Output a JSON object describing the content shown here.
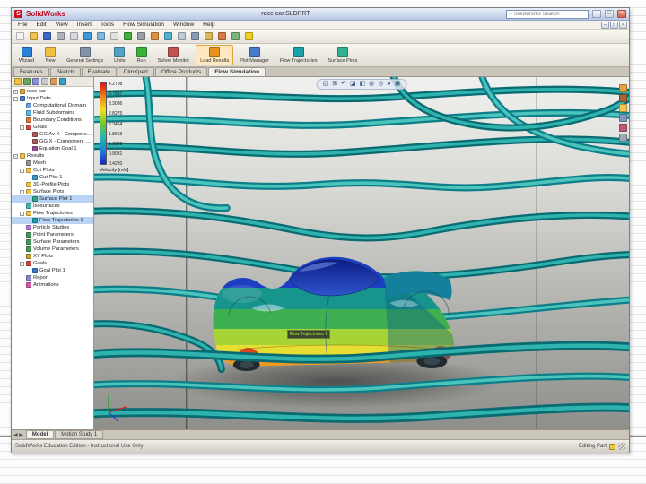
{
  "window": {
    "app_name": "SolidWorks",
    "logo_letter": "S",
    "document_title": "race car.SLDPRT",
    "search_placeholder": "SolidWorks Search",
    "window_buttons": {
      "minimize": "─",
      "maximize": "□",
      "close": "×"
    },
    "menus": [
      "File",
      "Edit",
      "View",
      "Insert",
      "Tools",
      "Flow Simulation",
      "Window",
      "Help"
    ],
    "std_toolbar": [
      {
        "name": "new-icon",
        "color": "#f4f4f4"
      },
      {
        "name": "open-icon",
        "color": "#f2c24a"
      },
      {
        "name": "save-icon",
        "color": "#3f69c8"
      },
      {
        "name": "print-icon",
        "color": "#aeb2ba"
      },
      {
        "name": "print-preview-icon",
        "color": "#d5dae2"
      },
      {
        "name": "undo-icon",
        "color": "#3c9ad8"
      },
      {
        "name": "redo-icon",
        "color": "#7db8e0"
      },
      {
        "name": "select-icon",
        "color": "#e2e2de"
      },
      {
        "name": "rebuild-icon",
        "color": "#3fae3f"
      },
      {
        "name": "options-icon",
        "color": "#98a0a8"
      },
      {
        "name": "edit-appearance-icon",
        "color": "#e09040"
      },
      {
        "name": "section-view-icon",
        "color": "#52b2d2"
      },
      {
        "name": "view-orientation-icon",
        "color": "#c2cad8"
      },
      {
        "name": "display-style-icon",
        "color": "#8a9ab8"
      },
      {
        "name": "hide-show-icon",
        "color": "#d8ba58"
      },
      {
        "name": "appearances-icon",
        "color": "#d87a42"
      },
      {
        "name": "scene-icon",
        "color": "#7ab878"
      },
      {
        "name": "help-icon",
        "color": "#f0d022"
      }
    ],
    "command_buttons": [
      {
        "name": "wizard-button",
        "label": "Wizard",
        "color": "#2a80d4"
      },
      {
        "name": "new-project-button",
        "label": "New",
        "color": "#f0c040"
      },
      {
        "name": "general-settings-button",
        "label": "General Settings",
        "color": "#8292a8"
      },
      {
        "name": "units-button",
        "label": "Units",
        "color": "#52a2c8"
      },
      {
        "name": "run-button",
        "label": "Run",
        "color": "#3ab23a"
      },
      {
        "name": "solver-monitor-button",
        "label": "Solver Monitor",
        "color": "#c25252"
      },
      {
        "name": "load-results-button",
        "label": "Load Results",
        "color": "#e89222",
        "active": true
      },
      {
        "name": "plot-manager-button",
        "label": "Plot Manager",
        "color": "#4a7ac8"
      },
      {
        "name": "flow-trajectories-button",
        "label": "Flow Trajectories",
        "color": "#1aa2aa"
      },
      {
        "name": "surface-plots-button",
        "label": "Surface Plots",
        "color": "#32b092"
      }
    ],
    "tabs": [
      {
        "label": "Features"
      },
      {
        "label": "Sketch"
      },
      {
        "label": "Evaluate"
      },
      {
        "label": "DimXpert"
      },
      {
        "label": "Office Products"
      },
      {
        "label": "Flow Simulation",
        "active": true
      }
    ],
    "panel_tabs": [
      {
        "name": "featuremanager-tab-icon",
        "color": "#f0c040"
      },
      {
        "name": "propertymanager-tab-icon",
        "color": "#68a858"
      },
      {
        "name": "configurationmanager-tab-icon",
        "color": "#8890d8"
      },
      {
        "name": "dimxpertmanager-tab-icon",
        "color": "#c8c8c8"
      },
      {
        "name": "displaymanager-tab-icon",
        "color": "#d89858"
      },
      {
        "name": "flow-simulation-tab-icon",
        "color": "#38a0c8"
      }
    ],
    "tree": {
      "items": [
        {
          "depth": 0,
          "expand": "-",
          "label": "race car",
          "color": "#d8a838",
          "name": "tree-item-part"
        },
        {
          "depth": 0,
          "expand": "-",
          "label": "Input Data",
          "color": "#4a78c8",
          "name": "tree-item-input-data"
        },
        {
          "depth": 1,
          "expand": "",
          "label": "Computational Domain",
          "color": "#6f9fe0",
          "name": "tree-item-computational-domain"
        },
        {
          "depth": 1,
          "expand": "",
          "label": "Fluid Subdomains",
          "color": "#58b8e0",
          "name": "tree-item-fluid-subdomains"
        },
        {
          "depth": 1,
          "expand": "",
          "label": "Boundary Conditions",
          "color": "#e07838",
          "name": "tree-item-boundary-conditions"
        },
        {
          "depth": 1,
          "expand": "-",
          "label": "Goals",
          "color": "#d04848",
          "name": "tree-item-goals"
        },
        {
          "depth": 2,
          "expand": "",
          "label": "GG Av X - Component of...",
          "color": "#b05858",
          "name": "tree-item-goal-av-x"
        },
        {
          "depth": 2,
          "expand": "",
          "label": "GG X - Component of F...",
          "color": "#b05858",
          "name": "tree-item-goal-x"
        },
        {
          "depth": 2,
          "expand": "",
          "label": "Equation Goal 1",
          "color": "#a04898",
          "name": "tree-item-equation-goal-1"
        },
        {
          "depth": 0,
          "expand": "-",
          "label": "Results",
          "color": "#efc34a",
          "name": "tree-item-results"
        },
        {
          "depth": 1,
          "expand": "",
          "label": "Mesh",
          "color": "#909090",
          "name": "tree-item-mesh"
        },
        {
          "depth": 1,
          "expand": "-",
          "label": "Cut Plots",
          "color": "#efc34a",
          "name": "tree-item-cut-plots"
        },
        {
          "depth": 2,
          "expand": "",
          "label": "Cut Plot 1",
          "color": "#3898c8",
          "name": "tree-item-cut-plot-1"
        },
        {
          "depth": 1,
          "expand": "",
          "label": "3D-Profile Plots",
          "color": "#efc34a",
          "name": "tree-item-3d-profile-plots"
        },
        {
          "depth": 1,
          "expand": "-",
          "label": "Surface Plots",
          "color": "#efc34a",
          "name": "tree-item-surface-plots"
        },
        {
          "depth": 2,
          "expand": "",
          "label": "Surface Plot 1",
          "color": "#30a888",
          "selected": true,
          "name": "tree-item-surface-plot-1"
        },
        {
          "depth": 1,
          "expand": "",
          "label": "Isosurfaces",
          "color": "#48b8b0",
          "name": "tree-item-isosurfaces"
        },
        {
          "depth": 1,
          "expand": "-",
          "label": "Flow Trajectories",
          "color": "#efc34a",
          "name": "tree-item-flow-trajectories"
        },
        {
          "depth": 2,
          "expand": "",
          "label": "Flow Trajectories 1",
          "color": "#18a0a8",
          "selected": true,
          "name": "tree-item-flow-trajectories-1"
        },
        {
          "depth": 1,
          "expand": "",
          "label": "Particle Studies",
          "color": "#b878d8",
          "name": "tree-item-particle-studies"
        },
        {
          "depth": 1,
          "expand": "",
          "label": "Point Parameters",
          "color": "#489858",
          "name": "tree-item-point-parameters"
        },
        {
          "depth": 1,
          "expand": "",
          "label": "Surface Parameters",
          "color": "#489858",
          "name": "tree-item-surface-parameters"
        },
        {
          "depth": 1,
          "expand": "",
          "label": "Volume Parameters",
          "color": "#489858",
          "name": "tree-item-volume-parameters"
        },
        {
          "depth": 1,
          "expand": "",
          "label": "XY Plots",
          "color": "#c8a030",
          "name": "tree-item-xy-plots"
        },
        {
          "depth": 1,
          "expand": "-",
          "label": "Goals",
          "color": "#d04848",
          "name": "tree-item-goals-results"
        },
        {
          "depth": 2,
          "expand": "",
          "label": "Goal Plot 1",
          "color": "#3878c8",
          "name": "tree-item-goal-plot-1"
        },
        {
          "depth": 1,
          "expand": "",
          "label": "Report",
          "color": "#8888c8",
          "name": "tree-item-report"
        },
        {
          "depth": 1,
          "expand": "",
          "label": "Animations",
          "color": "#d858a8",
          "name": "tree-item-animations"
        }
      ]
    },
    "viewport": {
      "legend": {
        "title": "Velocity [m/s]",
        "values": [
          "4.2708",
          "3.7897",
          "3.3086",
          "2.8275",
          "2.3464",
          "1.8653",
          "1.3842",
          "0.9031",
          "0.4220"
        ]
      },
      "callout": "Flow Trajectories 1",
      "headsup": [
        {
          "name": "zoom-fit-icon",
          "glyph": "◱"
        },
        {
          "name": "zoom-area-icon",
          "glyph": "⊞"
        },
        {
          "name": "previous-view-icon",
          "glyph": "↶"
        },
        {
          "name": "section-view-icon",
          "glyph": "◪"
        },
        {
          "name": "view-orientation-icon",
          "glyph": "◧"
        },
        {
          "name": "display-style-icon",
          "glyph": "◍"
        },
        {
          "name": "hide-show-icon",
          "glyph": "◎"
        },
        {
          "name": "appearances-icon",
          "glyph": "◕"
        },
        {
          "name": "scene-icon",
          "glyph": "▣"
        }
      ],
      "task_pane": [
        {
          "name": "task-pane-resources-icon",
          "color": "#e8a040"
        },
        {
          "name": "task-pane-design-library-icon",
          "color": "#a06838"
        },
        {
          "name": "task-pane-file-explorer-icon",
          "color": "#f0c850"
        },
        {
          "name": "task-pane-view-palette-icon",
          "color": "#8098c0"
        },
        {
          "name": "task-pane-appearances-icon",
          "color": "#c05878"
        },
        {
          "name": "task-pane-custom-properties-icon",
          "color": "#98a8b8"
        }
      ]
    },
    "bottom_tabs": [
      {
        "label": "Model",
        "active": true
      },
      {
        "label": "Motion Study 1"
      }
    ],
    "bottom_arrows": "◀ ▶",
    "status": {
      "left": "SolidWorks Education Edition - Instructional Use Only",
      "right": "Editing Part"
    }
  },
  "colors": {
    "selection": "#b9d3f3",
    "streamline_dark": "#0a6a72",
    "streamline_light": "#2fb3ae",
    "legend_max": "#e01818",
    "legend_min": "#1428c8"
  }
}
